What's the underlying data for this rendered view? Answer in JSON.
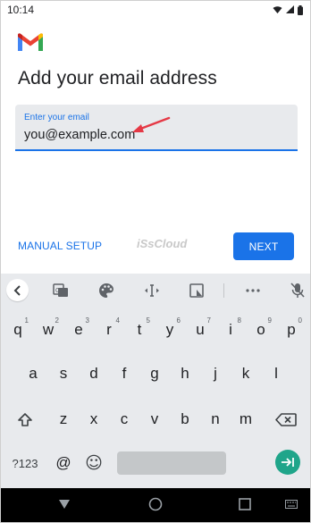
{
  "status_bar": {
    "time": "10:14"
  },
  "page": {
    "title": "Add your email address",
    "email_field": {
      "label": "Enter your email",
      "value": "you@example.com"
    },
    "manual_setup_label": "MANUAL SETUP",
    "watermark": "iSsCloud",
    "next_label": "NEXT"
  },
  "colors": {
    "accent": "#1a73e8",
    "annotation": "#e53946",
    "enter_key": "#1fa58a"
  },
  "keyboard": {
    "toolbar_icons": [
      "back-chevron-icon",
      "translate-icon",
      "palette-icon",
      "text-select-icon",
      "floating-keyboard-icon",
      "more-icon",
      "mic-off-icon"
    ],
    "row1": [
      {
        "k": "q",
        "h": "1"
      },
      {
        "k": "w",
        "h": "2"
      },
      {
        "k": "e",
        "h": "3"
      },
      {
        "k": "r",
        "h": "4"
      },
      {
        "k": "t",
        "h": "5"
      },
      {
        "k": "y",
        "h": "6"
      },
      {
        "k": "u",
        "h": "7"
      },
      {
        "k": "i",
        "h": "8"
      },
      {
        "k": "o",
        "h": "9"
      },
      {
        "k": "p",
        "h": "0"
      }
    ],
    "row2": [
      "a",
      "s",
      "d",
      "f",
      "g",
      "h",
      "j",
      "k",
      "l"
    ],
    "row3": [
      "z",
      "x",
      "c",
      "v",
      "b",
      "n",
      "m"
    ],
    "symbols_label": "?123",
    "at_label": "@",
    "emoji_glyph": "☺"
  }
}
